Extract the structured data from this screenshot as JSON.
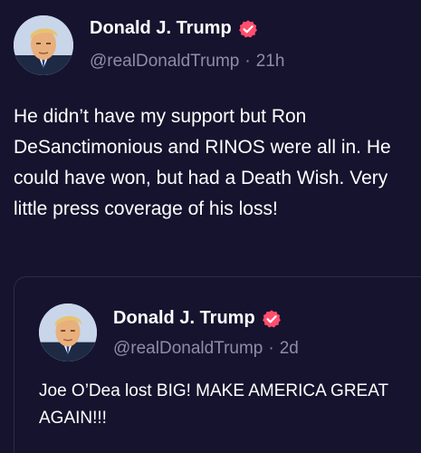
{
  "post": {
    "author": {
      "display_name": "Donald J. Trump",
      "handle": "@realDonaldTrump",
      "separator": "·",
      "time": "21h",
      "verified_icon": "verified-badge-icon"
    },
    "text": "He didn’t have my support but Ron DeSanctimonious and RINOS were all in. He could have won, but had a Death Wish. Very little press coverage of his loss!"
  },
  "quoted_post": {
    "author": {
      "display_name": "Donald J. Trump",
      "handle": "@realDonaldTrump",
      "separator": "·",
      "time": "2d",
      "verified_icon": "verified-badge-icon"
    },
    "text": "Joe O’Dea lost BIG! MAKE AMERICA GREAT AGAIN!!!"
  },
  "colors": {
    "background": "#16132e",
    "text": "#ffffff",
    "muted": "#8f8ca8",
    "verified": "#ff4d6d",
    "card_border": "#2e2a4a"
  }
}
